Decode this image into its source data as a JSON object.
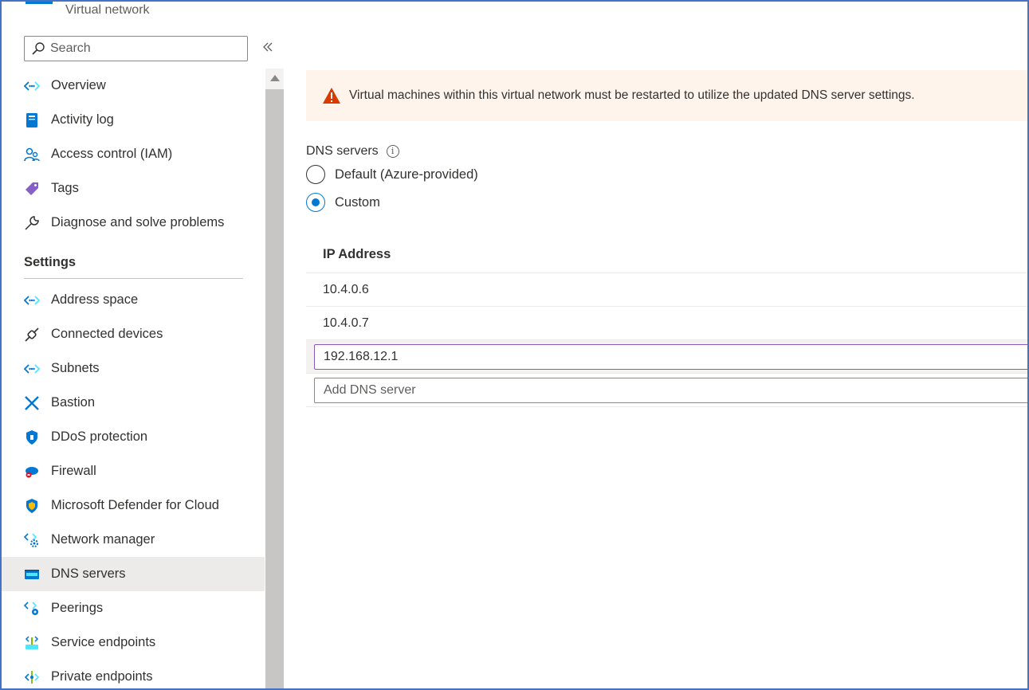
{
  "header": {
    "resource_type": "Virtual network"
  },
  "search": {
    "placeholder": "Search"
  },
  "sidebar": {
    "items_top": [
      {
        "label": "Overview",
        "icon": "vnet-icon"
      },
      {
        "label": "Activity log",
        "icon": "activity-log-icon"
      },
      {
        "label": "Access control (IAM)",
        "icon": "iam-icon"
      },
      {
        "label": "Tags",
        "icon": "tag-icon"
      },
      {
        "label": "Diagnose and solve problems",
        "icon": "wrench-icon"
      }
    ],
    "settings_heading": "Settings",
    "items_settings": [
      {
        "label": "Address space",
        "icon": "vnet-icon"
      },
      {
        "label": "Connected devices",
        "icon": "plug-icon"
      },
      {
        "label": "Subnets",
        "icon": "vnet-icon"
      },
      {
        "label": "Bastion",
        "icon": "bastion-icon"
      },
      {
        "label": "DDoS protection",
        "icon": "shield-icon"
      },
      {
        "label": "Firewall",
        "icon": "firewall-icon"
      },
      {
        "label": "Microsoft Defender for Cloud",
        "icon": "defender-icon"
      },
      {
        "label": "Network manager",
        "icon": "network-manager-icon"
      },
      {
        "label": "DNS servers",
        "icon": "dns-icon",
        "active": true
      },
      {
        "label": "Peerings",
        "icon": "peering-icon"
      },
      {
        "label": "Service endpoints",
        "icon": "service-endpoint-icon"
      },
      {
        "label": "Private endpoints",
        "icon": "private-endpoint-icon"
      }
    ]
  },
  "main": {
    "warning_text": "Virtual machines within this virtual network must be restarted to utilize the updated DNS server settings.",
    "dns_label": "DNS servers",
    "options": [
      {
        "label": "Default (Azure-provided)",
        "checked": false
      },
      {
        "label": "Custom",
        "checked": true
      }
    ],
    "table": {
      "header": "IP Address",
      "rows": [
        "10.4.0.6",
        "10.4.0.7"
      ],
      "editing_value": "192.168.12.1",
      "add_placeholder": "Add DNS server"
    }
  },
  "colors": {
    "accent": "#0078d4",
    "warning_bg": "#fff4ec",
    "warning_icon": "#d83b01",
    "active_bg": "#edebe9"
  }
}
